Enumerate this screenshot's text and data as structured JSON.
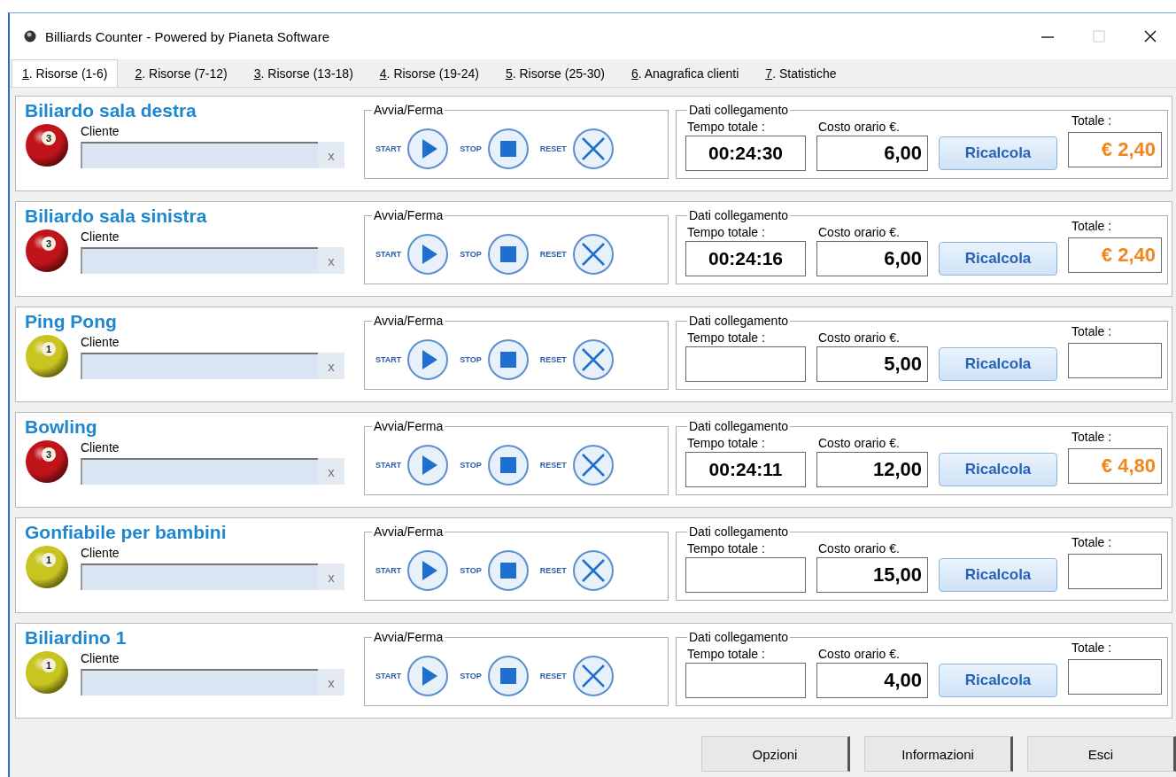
{
  "window": {
    "title": "Billiards Counter - Powered by Pianeta Software"
  },
  "tabs": [
    {
      "label": "1. Risorse (1-6)",
      "selected": true
    },
    {
      "label": "2. Risorse (7-12)",
      "selected": false
    },
    {
      "label": "3. Risorse (13-18)",
      "selected": false
    },
    {
      "label": "4. Risorse (19-24)",
      "selected": false
    },
    {
      "label": "5. Risorse (25-30)",
      "selected": false
    },
    {
      "label": "6. Anagrafica clienti",
      "selected": false
    },
    {
      "label": "7. Statistiche",
      "selected": false
    }
  ],
  "resources": [
    {
      "name": "Biliardo sala destra",
      "ball": {
        "color": "#c0141a",
        "number": "3"
      },
      "client_label": "Cliente",
      "clear": "x",
      "controls_title": "Avvia/Ferma",
      "start": "START",
      "stop": "STOP",
      "reset": "RESET",
      "data_title": "Dati collegamento",
      "time_label": "Tempo totale :",
      "cost_label": "Costo orario €.",
      "total_label": "Totale :",
      "time": "00:24:30",
      "cost": "6,00",
      "recalc": "Ricalcola",
      "total": "€ 2,40"
    },
    {
      "name": "Biliardo sala sinistra",
      "ball": {
        "color": "#c0141a",
        "number": "3"
      },
      "client_label": "Cliente",
      "clear": "x",
      "controls_title": "Avvia/Ferma",
      "start": "START",
      "stop": "STOP",
      "reset": "RESET",
      "data_title": "Dati collegamento",
      "time_label": "Tempo totale :",
      "cost_label": "Costo orario €.",
      "total_label": "Totale :",
      "time": "00:24:16",
      "cost": "6,00",
      "recalc": "Ricalcola",
      "total": "€ 2,40"
    },
    {
      "name": "Ping Pong",
      "ball": {
        "color": "#c8c420",
        "number": "1"
      },
      "client_label": "Cliente",
      "clear": "x",
      "controls_title": "Avvia/Ferma",
      "start": "START",
      "stop": "STOP",
      "reset": "RESET",
      "data_title": "Dati collegamento",
      "time_label": "Tempo totale :",
      "cost_label": "Costo orario €.",
      "total_label": "Totale :",
      "cost": "5,00",
      "recalc": "Ricalcola"
    },
    {
      "name": "Bowling",
      "ball": {
        "color": "#c0141a",
        "number": "3"
      },
      "client_label": "Cliente",
      "clear": "x",
      "controls_title": "Avvia/Ferma",
      "start": "START",
      "stop": "STOP",
      "reset": "RESET",
      "data_title": "Dati collegamento",
      "time_label": "Tempo totale :",
      "cost_label": "Costo orario €.",
      "total_label": "Totale :",
      "time": "00:24:11",
      "cost": "12,00",
      "recalc": "Ricalcola",
      "total": "€ 4,80"
    },
    {
      "name": "Gonfiabile per bambini",
      "ball": {
        "color": "#c8c420",
        "number": "1"
      },
      "client_label": "Cliente",
      "clear": "x",
      "controls_title": "Avvia/Ferma",
      "start": "START",
      "stop": "STOP",
      "reset": "RESET",
      "data_title": "Dati collegamento",
      "time_label": "Tempo totale :",
      "cost_label": "Costo orario €.",
      "total_label": "Totale :",
      "cost": "15,00",
      "recalc": "Ricalcola"
    },
    {
      "name": "Biliardino 1",
      "ball": {
        "color": "#c8c420",
        "number": "1"
      },
      "client_label": "Cliente",
      "clear": "x",
      "controls_title": "Avvia/Ferma",
      "start": "START",
      "stop": "STOP",
      "reset": "RESET",
      "data_title": "Dati collegamento",
      "time_label": "Tempo totale :",
      "cost_label": "Costo orario €.",
      "total_label": "Totale :",
      "cost": "4,00",
      "recalc": "Ricalcola"
    }
  ],
  "buttons": [
    "Opzioni",
    "Informazioni",
    "Esci"
  ]
}
